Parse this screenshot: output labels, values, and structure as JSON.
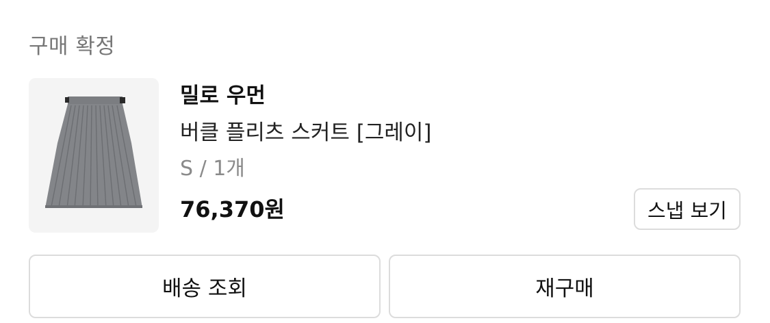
{
  "order": {
    "status_label": "구매 확정"
  },
  "product": {
    "brand": "밀로 우먼",
    "name": "버클 플리츠 스커트 [그레이]",
    "option": "S / 1개",
    "price": "76,370원",
    "image_icon": "pleated-skirt-image",
    "image_color": "#838589"
  },
  "buttons": {
    "snap": "스냅 보기",
    "tracking": "배송 조회",
    "reorder": "재구매"
  }
}
